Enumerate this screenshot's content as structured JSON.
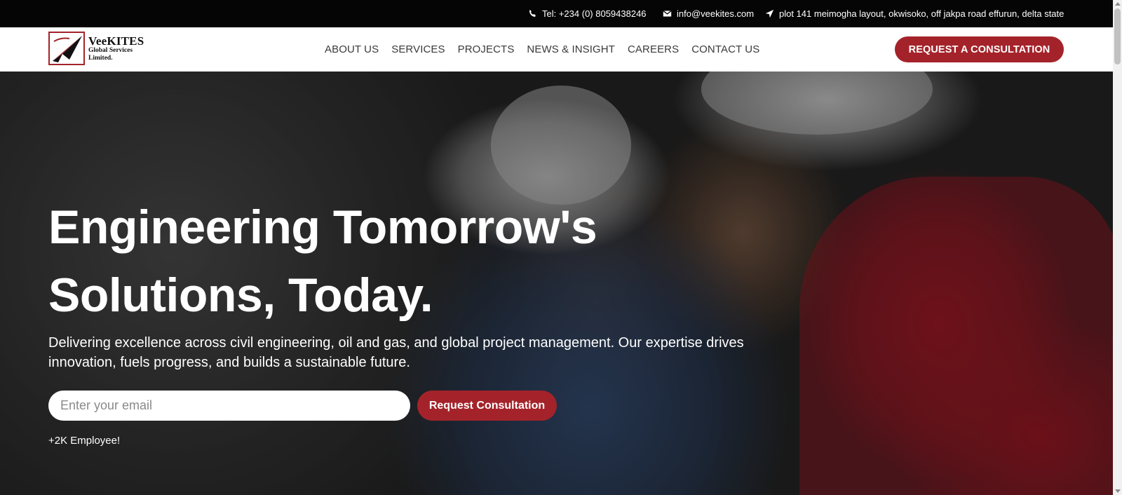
{
  "topbar": {
    "phone": "Tel: +234 (0) 8059438246",
    "email": "info@veekites.com",
    "address": "plot 141 meimogha layout, okwisoko, off jakpa road effurun, delta state",
    "icons": [
      "phone-icon",
      "envelope-icon",
      "location-arrow-icon"
    ]
  },
  "header": {
    "logo": {
      "name": "VeeKITES",
      "line2": "Global Services",
      "line3": "Limited."
    },
    "nav": [
      "ABOUT US",
      "SERVICES",
      "PROJECTS",
      "NEWS & INSIGHT",
      "CAREERS",
      "CONTACT US"
    ],
    "cta": "REQUEST A CONSULTATION"
  },
  "hero": {
    "title_line1": "Engineering Tomorrow's",
    "title_line2": "Solutions, Today.",
    "description": "Delivering excellence across civil engineering, oil and gas, and global project management. Our expertise drives innovation, fuels progress, and builds a sustainable future.",
    "email_placeholder": "Enter your email",
    "button": "Request Consultation",
    "employees": "+2K Employee!"
  },
  "colors": {
    "accent": "#a4232a",
    "topbar": "#050505"
  }
}
